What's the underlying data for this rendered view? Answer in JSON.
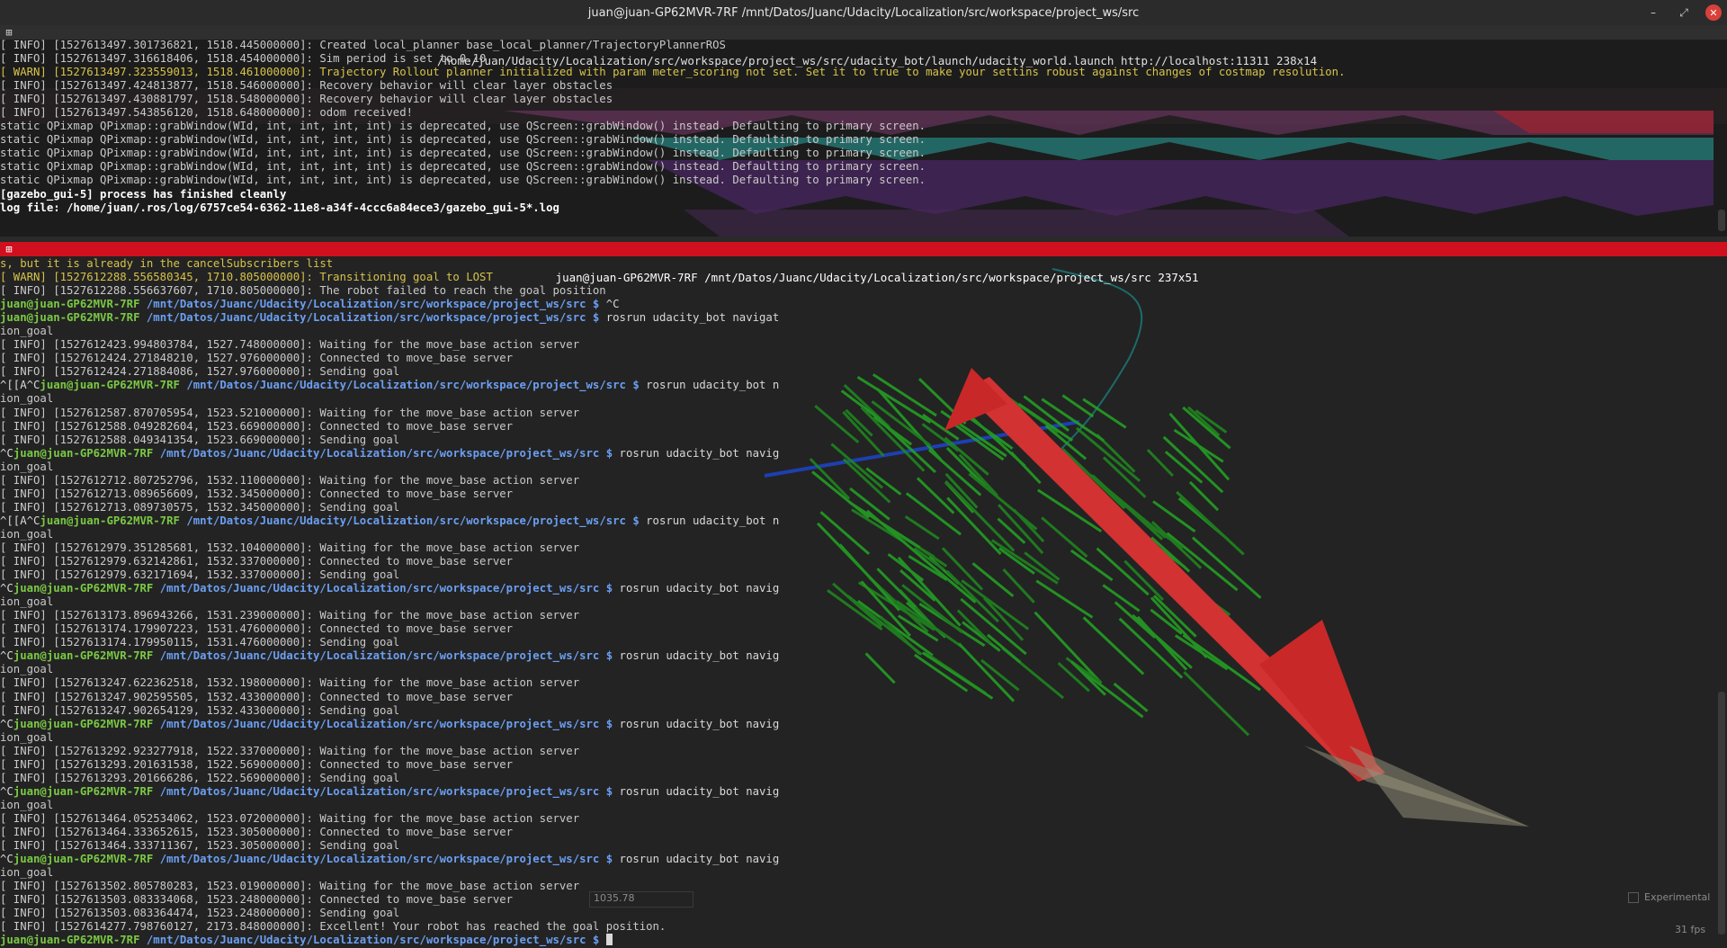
{
  "window": {
    "title": "juan@juan-GP62MVR-7RF /mnt/Datos/Juanc/Udacity/Localization/src/workspace/project_ws/src",
    "controls": {
      "minimize": "–",
      "maximize": "⤢",
      "close": "✕"
    }
  },
  "top_pane": {
    "title": "/home/juan/Udacity/Localization/src/workspace/project_ws/src/udacity_bot/launch/udacity_world.launch http://localhost:11311 238x14",
    "lines": [
      {
        "t": "[ INFO] [1527613497.301736821, 1518.445000000]: Created local_planner base_local_planner/TrajectoryPlannerROS",
        "c": "info"
      },
      {
        "t": "[ INFO] [1527613497.316618406, 1518.454000000]: Sim period is set to 0.10",
        "c": "info"
      },
      {
        "t": "[ WARN] [1527613497.323559013, 1518.461000000]: Trajectory Rollout planner initialized with param meter_scoring not set. Set it to true to make your settins robust against changes of costmap resolution.",
        "c": "warn"
      },
      {
        "t": "[ INFO] [1527613497.424813877, 1518.546000000]: Recovery behavior will clear layer obstacles",
        "c": "info"
      },
      {
        "t": "[ INFO] [1527613497.430881797, 1518.548000000]: Recovery behavior will clear layer obstacles",
        "c": "info"
      },
      {
        "t": "[ INFO] [1527613497.543856120, 1518.648000000]: odom received!",
        "c": "info"
      },
      {
        "t": "static QPixmap QPixmap::grabWindow(WId, int, int, int, int) is deprecated, use QScreen::grabWindow() instead. Defaulting to primary screen.",
        "c": "info"
      },
      {
        "t": "static QPixmap QPixmap::grabWindow(WId, int, int, int, int) is deprecated, use QScreen::grabWindow() instead. Defaulting to primary screen.",
        "c": "info"
      },
      {
        "t": "static QPixmap QPixmap::grabWindow(WId, int, int, int, int) is deprecated, use QScreen::grabWindow() instead. Defaulting to primary screen.",
        "c": "info"
      },
      {
        "t": "static QPixmap QPixmap::grabWindow(WId, int, int, int, int) is deprecated, use QScreen::grabWindow() instead. Defaulting to primary screen.",
        "c": "info"
      },
      {
        "t": "static QPixmap QPixmap::grabWindow(WId, int, int, int, int) is deprecated, use QScreen::grabWindow() instead. Defaulting to primary screen.",
        "c": "info"
      },
      {
        "t": "[gazebo_gui-5] process has finished cleanly",
        "c": "bold"
      },
      {
        "t": "log file: /home/juan/.ros/log/6757ce54-6362-11e8-a34f-4ccc6a84ece3/gazebo_gui-5*.log",
        "c": "bold"
      }
    ]
  },
  "bottom_pane": {
    "title": "juan@juan-GP62MVR-7RF /mnt/Datos/Juanc/Udacity/Localization/src/workspace/project_ws/src 237x51",
    "prompt_user": "juan@juan-GP62MVR-7RF",
    "prompt_path": "/mnt/Datos/Juanc/Udacity/Localization/src/workspace/project_ws/src $",
    "lines": [
      {
        "t": "s, but it is already in the cancelSubscribers list",
        "c": "warn"
      },
      {
        "t": "[ WARN] [1527612288.556580345, 1710.805000000]: Transitioning goal to LOST",
        "c": "warn"
      },
      {
        "t": "[ INFO] [1527612288.556637607, 1710.805000000]: The robot failed to reach the goal position",
        "c": "info"
      },
      {
        "p": "",
        "cmd": "^C"
      },
      {
        "p": "",
        "cmd": "rosrun udacity_bot navigat"
      },
      {
        "t": "ion_goal",
        "c": "info"
      },
      {
        "t": "[ INFO] [1527612423.994803784, 1527.748000000]: Waiting for the move_base action server",
        "c": "info"
      },
      {
        "t": "[ INFO] [1527612424.271848210, 1527.976000000]: Connected to move_base server",
        "c": "info"
      },
      {
        "t": "[ INFO] [1527612424.271884086, 1527.976000000]: Sending goal",
        "c": "info"
      },
      {
        "p": "^[[A^C",
        "cmd": "rosrun udacity_bot n"
      },
      {
        "t": "ion_goal",
        "c": "info"
      },
      {
        "t": "[ INFO] [1527612587.870705954, 1523.521000000]: Waiting for the move_base action server",
        "c": "info"
      },
      {
        "t": "[ INFO] [1527612588.049282604, 1523.669000000]: Connected to move_base server",
        "c": "info"
      },
      {
        "t": "[ INFO] [1527612588.049341354, 1523.669000000]: Sending goal",
        "c": "info"
      },
      {
        "p": "^C",
        "cmd": "rosrun udacity_bot navig"
      },
      {
        "t": "ion_goal",
        "c": "info"
      },
      {
        "t": "[ INFO] [1527612712.807252796, 1532.110000000]: Waiting for the move_base action server",
        "c": "info"
      },
      {
        "t": "[ INFO] [1527612713.089656609, 1532.345000000]: Connected to move_base server",
        "c": "info"
      },
      {
        "t": "[ INFO] [1527612713.089730575, 1532.345000000]: Sending goal",
        "c": "info"
      },
      {
        "p": "^[[A^C",
        "cmd": "rosrun udacity_bot n"
      },
      {
        "t": "ion_goal",
        "c": "info"
      },
      {
        "t": "[ INFO] [1527612979.351285681, 1532.104000000]: Waiting for the move_base action server",
        "c": "info"
      },
      {
        "t": "[ INFO] [1527612979.632142861, 1532.337000000]: Connected to move_base server",
        "c": "info"
      },
      {
        "t": "[ INFO] [1527612979.632171694, 1532.337000000]: Sending goal",
        "c": "info"
      },
      {
        "p": "^C",
        "cmd": "rosrun udacity_bot navig"
      },
      {
        "t": "ion_goal",
        "c": "info"
      },
      {
        "t": "[ INFO] [1527613173.896943266, 1531.239000000]: Waiting for the move_base action server",
        "c": "info"
      },
      {
        "t": "[ INFO] [1527613174.179907223, 1531.476000000]: Connected to move_base server",
        "c": "info"
      },
      {
        "t": "[ INFO] [1527613174.179950115, 1531.476000000]: Sending goal",
        "c": "info"
      },
      {
        "p": "^C",
        "cmd": "rosrun udacity_bot navig"
      },
      {
        "t": "ion_goal",
        "c": "info"
      },
      {
        "t": "[ INFO] [1527613247.622362518, 1532.198000000]: Waiting for the move_base action server",
        "c": "info"
      },
      {
        "t": "[ INFO] [1527613247.902595505, 1532.433000000]: Connected to move_base server",
        "c": "info"
      },
      {
        "t": "[ INFO] [1527613247.902654129, 1532.433000000]: Sending goal",
        "c": "info"
      },
      {
        "p": "^C",
        "cmd": "rosrun udacity_bot navig"
      },
      {
        "t": "ion_goal",
        "c": "info"
      },
      {
        "t": "[ INFO] [1527613292.923277918, 1522.337000000]: Waiting for the move_base action server",
        "c": "info"
      },
      {
        "t": "[ INFO] [1527613293.201631538, 1522.569000000]: Connected to move_base server",
        "c": "info"
      },
      {
        "t": "[ INFO] [1527613293.201666286, 1522.569000000]: Sending goal",
        "c": "info"
      },
      {
        "p": "^C",
        "cmd": "rosrun udacity_bot navig"
      },
      {
        "t": "ion_goal",
        "c": "info"
      },
      {
        "t": "[ INFO] [1527613464.052534062, 1523.072000000]: Waiting for the move_base action server",
        "c": "info"
      },
      {
        "t": "[ INFO] [1527613464.333652615, 1523.305000000]: Connected to move_base server",
        "c": "info"
      },
      {
        "t": "[ INFO] [1527613464.333711367, 1523.305000000]: Sending goal",
        "c": "info"
      },
      {
        "p": "^C",
        "cmd": "rosrun udacity_bot navig"
      },
      {
        "t": "ion_goal",
        "c": "info"
      },
      {
        "t": "[ INFO] [1527613502.805780283, 1523.019000000]: Waiting for the move_base action server",
        "c": "info"
      },
      {
        "t": "[ INFO] [1527613503.083334068, 1523.248000000]: Connected to move_base server",
        "c": "info"
      },
      {
        "t": "[ INFO] [1527613503.083364474, 1523.248000000]: Sending goal",
        "c": "info"
      },
      {
        "t": "[ INFO] [1527614277.798760127, 2173.848000000]: Excellent! Your robot has reached the goal position.",
        "c": "info"
      },
      {
        "p": "",
        "cmd": "",
        "cursor": true
      }
    ]
  },
  "background_app": {
    "experimental_label": "Experimental",
    "fps": "31 fps",
    "elapsed_value": "1035.78"
  },
  "colors": {
    "bottom_title_bg": "#d0101e",
    "info_text": "#c9c9c9",
    "warn_text": "#d7c34a",
    "prompt_user": "#7ac943",
    "prompt_path": "#6b9ff2"
  }
}
